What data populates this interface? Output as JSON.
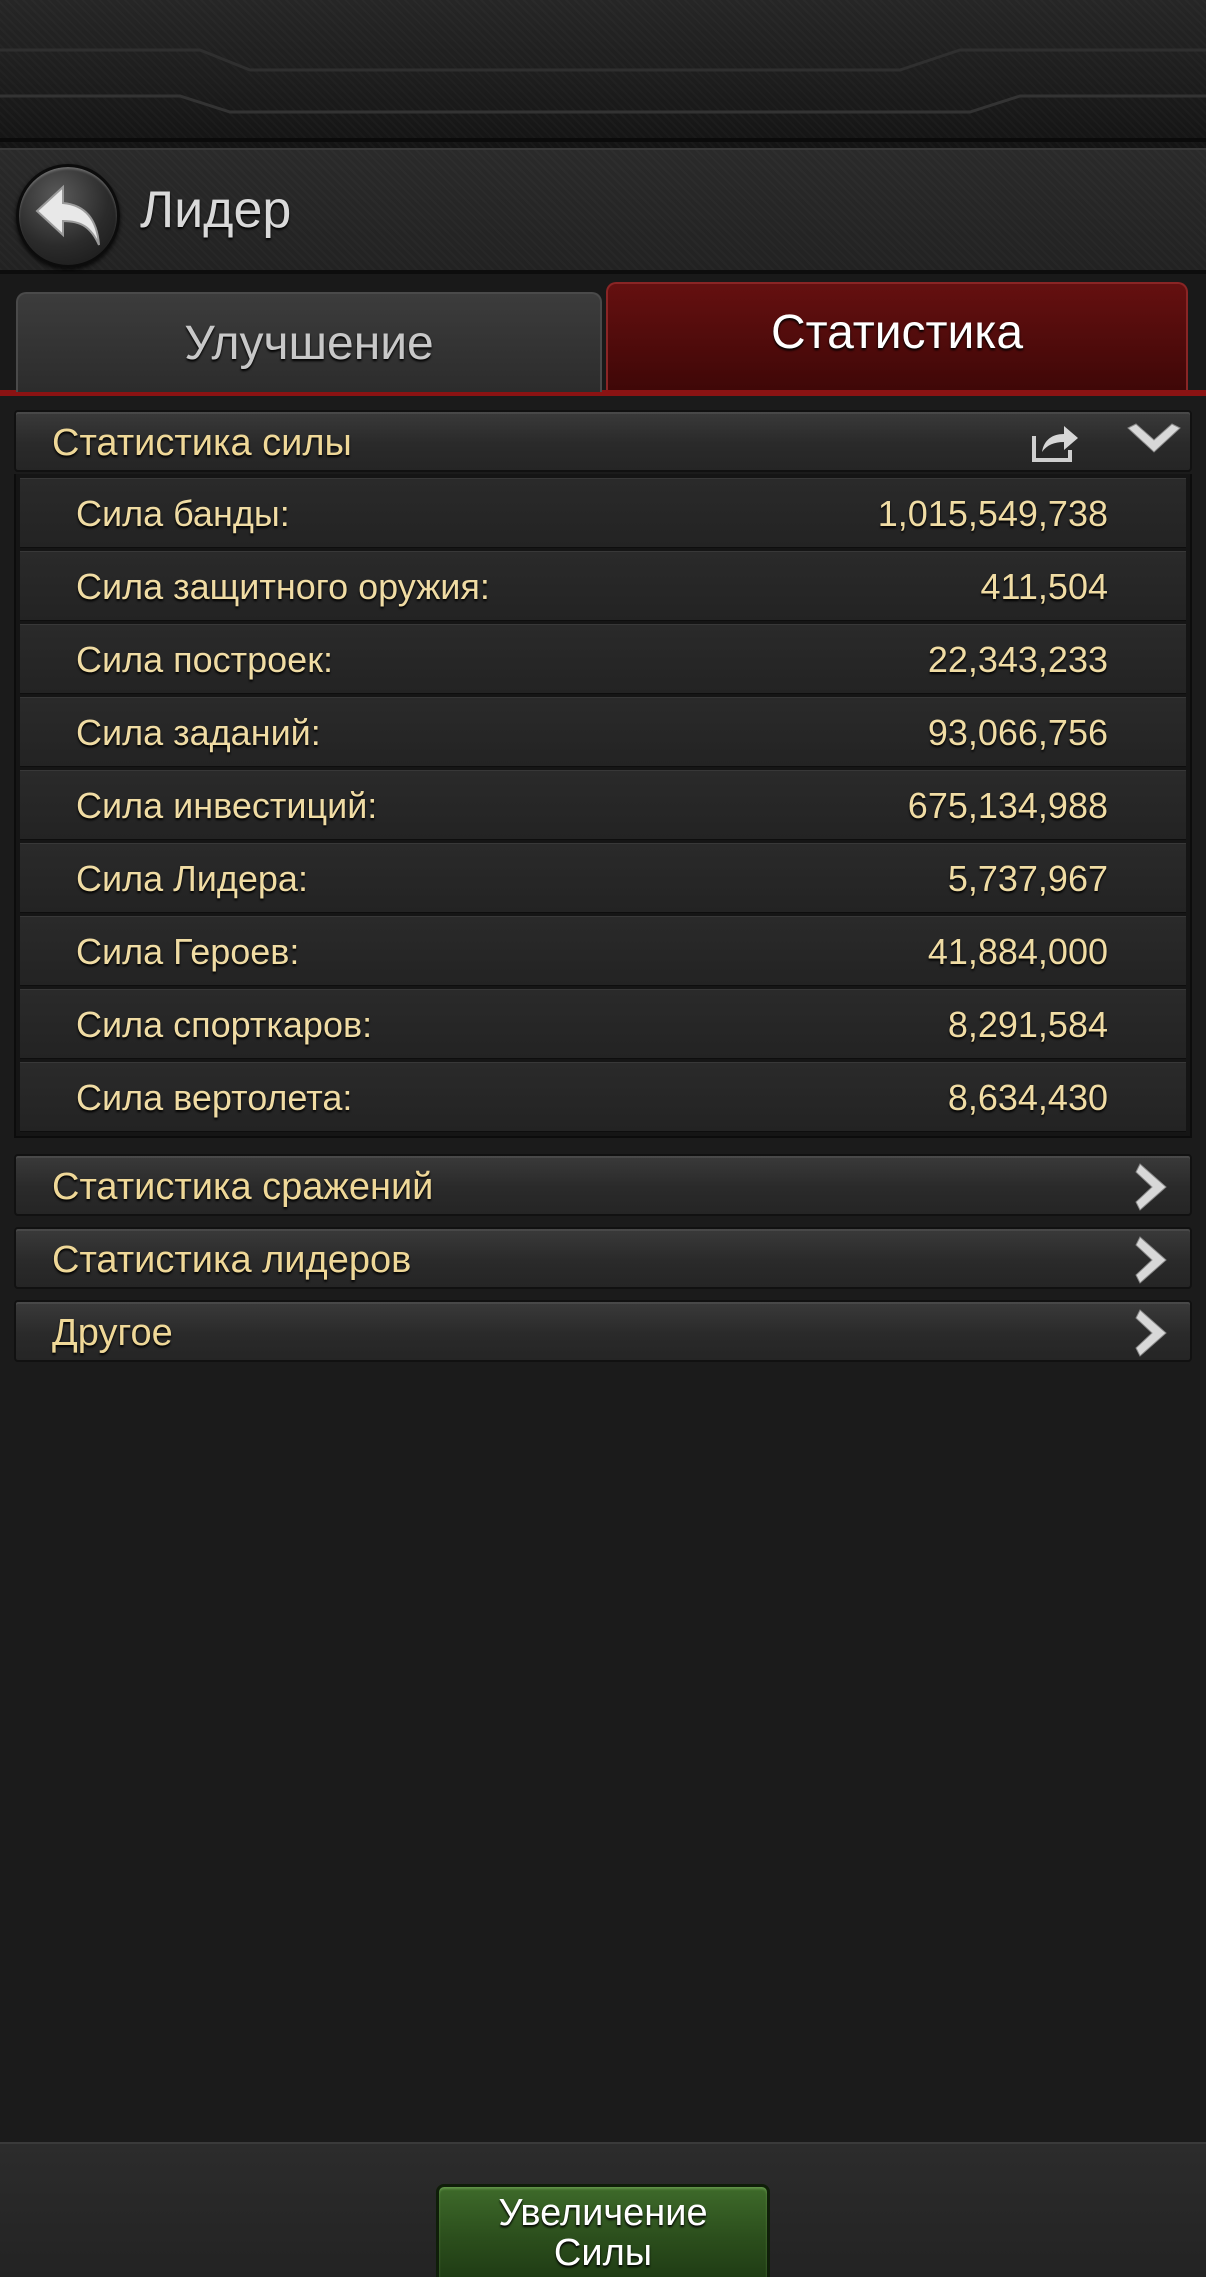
{
  "header": {
    "title": "Лидер"
  },
  "tabs": [
    {
      "label": "Улучшение",
      "active": false
    },
    {
      "label": "Статистика",
      "active": true
    }
  ],
  "power_stats": {
    "title": "Статистика силы",
    "rows": [
      {
        "label": "Сила банды:",
        "value": "1,015,549,738"
      },
      {
        "label": "Сила защитного оружия:",
        "value": "411,504"
      },
      {
        "label": "Сила построек:",
        "value": "22,343,233"
      },
      {
        "label": "Сила заданий:",
        "value": "93,066,756"
      },
      {
        "label": "Сила инвестиций:",
        "value": "675,134,988"
      },
      {
        "label": "Сила Лидера:",
        "value": "5,737,967"
      },
      {
        "label": "Сила Героев:",
        "value": "41,884,000"
      },
      {
        "label": "Сила спорткаров:",
        "value": "8,291,584"
      },
      {
        "label": "Сила вертолета:",
        "value": "8,634,430"
      }
    ]
  },
  "sections": [
    {
      "title": "Статистика сражений"
    },
    {
      "title": "Статистика лидеров"
    },
    {
      "title": "Другое"
    }
  ],
  "footer": {
    "boost_button_line1": "Увеличение",
    "boost_button_line2": "Силы"
  },
  "colors": {
    "accent_red": "#8b1313",
    "label_gold": "#f0dca4",
    "button_green": "#2b4e1c",
    "background": "#1b1b1b"
  }
}
